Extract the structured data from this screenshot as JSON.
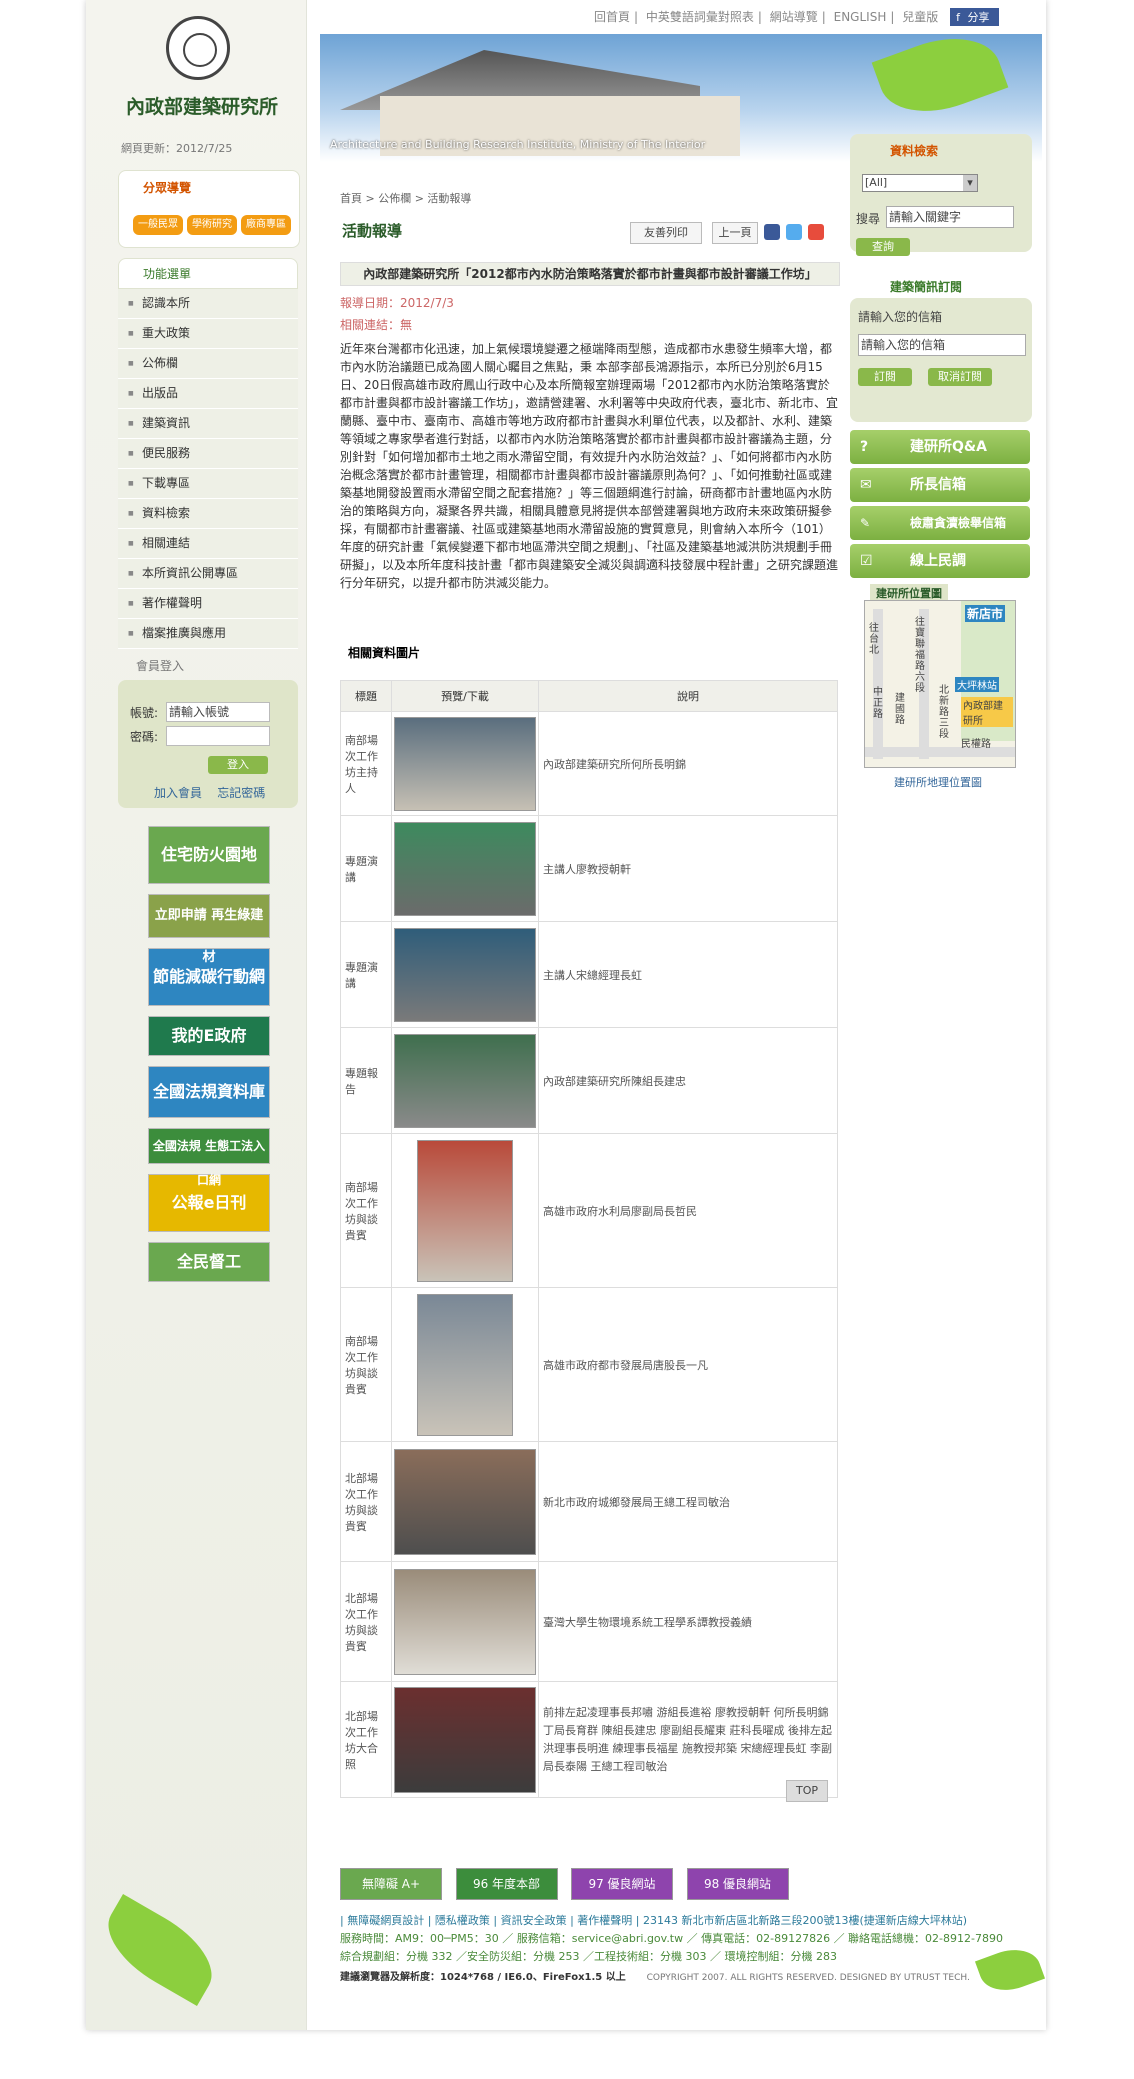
{
  "site": {
    "name": "內政部建築研究所",
    "update": "網頁更新：2012/7/25",
    "slogan": "Architecture and Building Research Institute, Ministry of The Interior"
  },
  "topnav": [
    "回首頁",
    "中英雙語詞彙對照表",
    "網站導覽",
    "ENGLISH",
    "兒童版"
  ],
  "share_label": "分享",
  "category_nav": {
    "title": "分眾導覽",
    "buttons": [
      "一般民眾",
      "學術研究",
      "廠商專區"
    ]
  },
  "menu": {
    "title": "功能選單",
    "items": [
      "認識本所",
      "重大政策",
      "公佈欄",
      "出版品",
      "建築資訊",
      "便民服務",
      "下載專區",
      "資料檢索",
      "相關連結",
      "本所資訊公開專區",
      "著作權聲明",
      "檔案推廣與應用"
    ]
  },
  "member": {
    "title": "會員登入",
    "account_label": "帳號:",
    "account_value": "請輸入帳號",
    "password_label": "密碼:",
    "login_button": "登入",
    "join": "加入會員",
    "forgot": "忘記密碼"
  },
  "banners": [
    {
      "text": "住宅防火園地",
      "color": "#6aa84f"
    },
    {
      "text": "立即申請 再生綠建材",
      "color": "#8aa24a"
    },
    {
      "text": "節能減碳行動網",
      "color": "#2e86c1"
    },
    {
      "text": "我的E政府",
      "color": "#1f7a4d"
    },
    {
      "text": "全國法規資料庫",
      "color": "#2e86c1"
    },
    {
      "text": "全國法規 生態工法入口網",
      "color": "#3c8d3c"
    },
    {
      "text": "公報e日刊",
      "color": "#e6b800"
    },
    {
      "text": "全民督工",
      "color": "#6aa84f"
    }
  ],
  "main": {
    "breadcrumb": "首頁 > 公佈欄 > 活動報導",
    "title": "活動報導",
    "print": "友善列印",
    "back": "上一頁",
    "news_title": "內政部建築研究所「2012都市內水防治策略落實於都市計畫與都市設計審議工作坊」",
    "date": "報導日期：2012/7/3",
    "link": "相關連結：無",
    "body": "近年來台灣都市化迅速，加上氣候環境變遷之極端降雨型態，造成都市水患發生頻率大增，都市內水防治議題已成為國人關心矚目之焦點，秉 本部李部長鴻源指示，本所已分別於6月15日、20日假高雄市政府鳳山行政中心及本所簡報室辦理兩場「2012都市內水防治策略落實於都市計畫與都市設計審議工作坊」，邀請營建署、水利署等中央政府代表，臺北市、新北市、宜蘭縣、臺中市、臺南市、高雄市等地方政府都市計畫與水利單位代表，以及都計、水利、建築等領域之專家學者進行對話，以都市內水防治策略落實於都市計畫與都市設計審議為主題，分別針對「如何增加都市土地之雨水滯留空間，有效提升內水防治效益？」、「如何將都市內水防治概念落實於都市計畫管理，相關都市計畫與都市設計審議原則為何？」、「如何推動社區或建築基地開發設置雨水滯留空間之配套措施？」等三個題綱進行討論，研商都市計畫地區內水防治的策略與方向，凝聚各界共識，相關具體意見將提供本部營建署與地方政府未來政策研擬參採，有關都市計畫審議、社區或建築基地雨水滯留設施的實質意見，則會納入本所今（101）年度的研究計畫「氣候變遷下都市地區滯洪空間之規劃」、「社區及建築基地減洪防洪規劃手冊研擬」，以及本所年度科技計畫「都市與建築安全減災與調適科技發展中程計畫」之研究課題進行分年研究，以提升都市防洪減災能力。",
    "related_title": "相關資料圖片",
    "table_headers": [
      "標題",
      "預覽/下載",
      "說明"
    ],
    "rows": [
      {
        "title": "南部場次工作坊主持人",
        "desc": "內政部建築研究所何所長明錦"
      },
      {
        "title": "專題演講",
        "desc": "主講人廖教授朝軒"
      },
      {
        "title": "專題演講",
        "desc": "主講人宋總經理長虹"
      },
      {
        "title": "專題報告",
        "desc": "內政部建築研究所陳組長建忠"
      },
      {
        "title": "南部場次工作坊與談貴賓",
        "desc": "高雄市政府水利局廖副局長哲民"
      },
      {
        "title": "南部場次工作坊與談貴賓",
        "desc": "高雄市政府都市發展局唐股長一凡"
      },
      {
        "title": "北部場次工作坊與談貴賓",
        "desc": "新北市政府城鄉發展局王總工程司敏治"
      },
      {
        "title": "北部場次工作坊與談貴賓",
        "desc": "臺灣大學生物環境系統工程學系譚教授義績"
      },
      {
        "title": "北部場次工作坊大合照",
        "desc": "前排左起凌理事長邦嘯 游組長進裕 廖教授朝軒 何所長明錦 丁局長育群 陳組長建忠 廖副組長耀東 莊科長曜成 後排左起洪理事長明進 練理事長福星 施教授邦築 宋總經理長虹 李副局長泰陽 王總工程司敏治"
      }
    ],
    "top": "TOP"
  },
  "right": {
    "search_title": "資料檢索",
    "select_value": "[All]",
    "search_label": "搜尋",
    "search_placeholder": "請輸入關鍵字",
    "search_button": "查詢",
    "subscribe_title": "建築簡訊訂閱",
    "email_label": "請輸入您的信箱",
    "email_placeholder": "請輸入您的信箱",
    "subscribe_button": "訂閱",
    "unsubscribe_button": "取消訂閱",
    "buttons": [
      "建研所Q&A",
      "所長信箱",
      "檢肅貪瀆檢舉信箱",
      "線上民調"
    ],
    "location_title": "建研所位置圖",
    "map_link": "建研所地理位置圖",
    "map_labels": [
      "往台北",
      "往寶聯福路六段",
      "新店市",
      "中正路",
      "建國路",
      "北新路三段",
      "大坪林站",
      "內政部建研所",
      "民權路"
    ]
  },
  "footer": {
    "awards": [
      {
        "text": "無障礙 A+",
        "color": "#6aa84f"
      },
      {
        "text": "96 年度本部",
        "color": "#3c8d3c"
      },
      {
        "text": "97 優良網站",
        "color": "#8e44ad"
      },
      {
        "text": "98 優良網站",
        "color": "#8e44ad"
      }
    ],
    "line1": "| 無障礙網頁設計 | 隱私權政策 | 資訊安全政策 | 著作權聲明 | 23143 新北市新店區北新路三段200號13樓(捷運新店線大坪林站)",
    "line2": "服務時間：AM9：00─PM5：30 ／ 服務信箱：service@abri.gov.tw ／ 傳真電話：02-89127826 ／ 聯絡電話總機：02-8912-7890",
    "line3": "綜合規劃組：分機 332 ／安全防災組：分機 253 ／工程技術組：分機 303 ／ 環境控制組：分機 283",
    "browser": "建議瀏覽器及解析度：1024*768 / IE6.0、FireFox1.5 以上",
    "copyright": "COPYRIGHT 2007. ALL RIGHTS RESERVED. DESIGNED BY UTRUST TECH."
  }
}
